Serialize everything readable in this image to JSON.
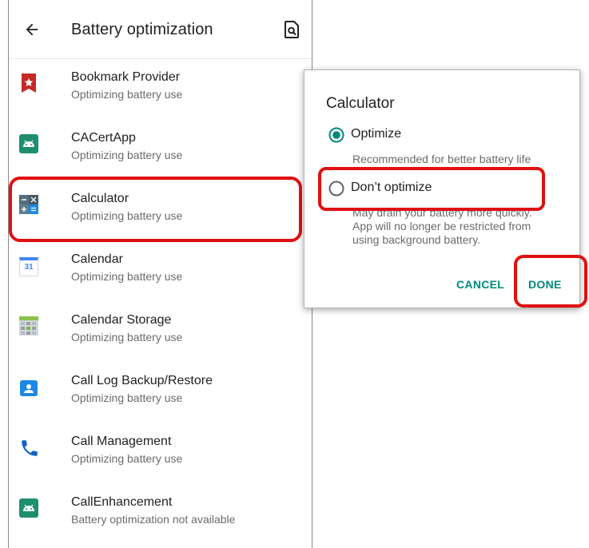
{
  "header": {
    "title": "Battery optimization",
    "back_icon": "arrow-back-icon",
    "action_icon": "search-document-icon"
  },
  "apps": [
    {
      "name": "Bookmark Provider",
      "status": "Optimizing battery use",
      "icon": "bookmark-star-icon"
    },
    {
      "name": "CACertApp",
      "status": "Optimizing battery use",
      "icon": "android-app-icon"
    },
    {
      "name": "Calculator",
      "status": "Optimizing battery use",
      "icon": "calculator-icon"
    },
    {
      "name": "Calendar",
      "status": "Optimizing battery use",
      "icon": "calendar-icon",
      "icon_text": "31"
    },
    {
      "name": "Calendar Storage",
      "status": "Optimizing battery use",
      "icon": "calendar-storage-icon"
    },
    {
      "name": "Call Log Backup/Restore",
      "status": "Optimizing battery use",
      "icon": "contact-card-icon"
    },
    {
      "name": "Call Management",
      "status": "Optimizing battery use",
      "icon": "phone-icon"
    },
    {
      "name": "CallEnhancement",
      "status": "Battery optimization not available",
      "icon": "android-app-icon"
    }
  ],
  "dialog": {
    "title": "Calculator",
    "options": [
      {
        "label": "Optimize",
        "description": "Recommended for better battery life",
        "selected": true
      },
      {
        "label": "Don’t optimize",
        "description_lines": [
          "May drain your battery more quickly.",
          "App will no longer be restricted from",
          "using background battery."
        ],
        "selected": false
      }
    ],
    "cancel_label": "CANCEL",
    "done_label": "DONE"
  },
  "colors": {
    "accent": "#00897b",
    "highlight": "#e01010"
  }
}
